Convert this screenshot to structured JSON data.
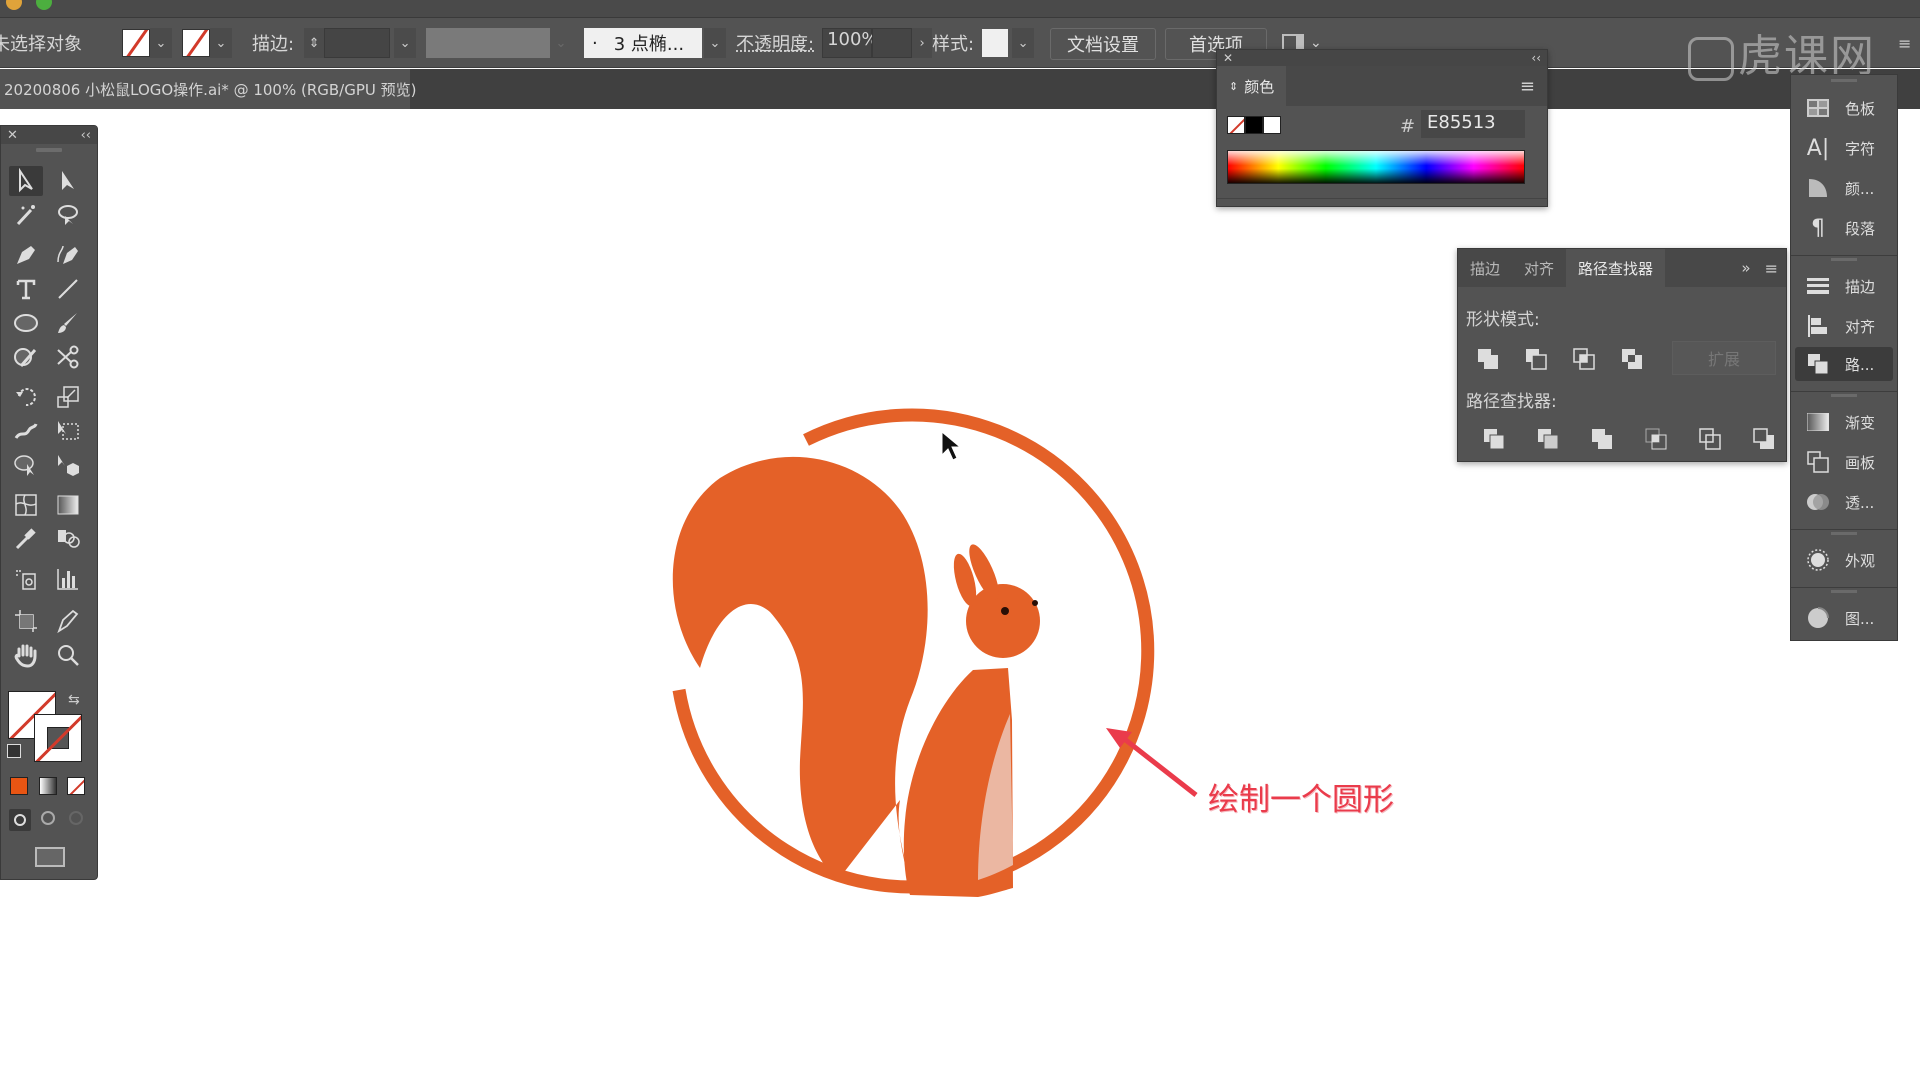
{
  "app": {
    "document_tab": "20200806 小松鼠LOGO操作.ai* @ 100% (RGB/GPU 预览)"
  },
  "control_bar": {
    "selection_label": "未选择对象",
    "stroke_label": "描边:",
    "stroke_value": "",
    "brush_value": "3 点椭...",
    "brush_bullet": "·",
    "opacity_label": "不透明度:",
    "opacity_value": "100%",
    "style_label": "样式:",
    "doc_settings_button": "文档设置",
    "preferences_button": "首选项"
  },
  "color_panel": {
    "title": "颜色",
    "hash_label": "#",
    "hex_value": "E85513",
    "collapse_glyph": "‹‹",
    "close_glyph": "✕"
  },
  "pathfinder_panel": {
    "tabs": [
      {
        "label": "描边",
        "active": false
      },
      {
        "label": "对齐",
        "active": false
      },
      {
        "label": "路径查找器",
        "active": true
      }
    ],
    "overflow_glyph": "»",
    "shape_modes_label": "形状模式:",
    "expand_button": "扩展",
    "pathfinders_label": "路径查找器:"
  },
  "right_dock": {
    "items": [
      {
        "label": "色板",
        "icon": "swatches-icon"
      },
      {
        "label": "字符",
        "icon": "character-icon"
      },
      {
        "label": "颜...",
        "icon": "color-guide-icon"
      },
      {
        "label": "段落",
        "icon": "paragraph-icon"
      },
      {
        "label": "描边",
        "icon": "stroke-icon"
      },
      {
        "label": "对齐",
        "icon": "align-icon"
      },
      {
        "label": "路...",
        "icon": "pathfinder-icon",
        "active": true
      },
      {
        "label": "渐变",
        "icon": "gradient-icon"
      },
      {
        "label": "画板",
        "icon": "artboards-icon"
      },
      {
        "label": "透...",
        "icon": "transparency-icon"
      },
      {
        "label": "外观",
        "icon": "appearance-icon"
      },
      {
        "label": "图...",
        "icon": "graphic-styles-icon"
      }
    ]
  },
  "tools_panel": {
    "close_glyph": "✕",
    "collapse_glyph": "‹‹"
  },
  "canvas": {
    "annotation": "绘制一个圆形",
    "logo_color": "#E85513",
    "belly_color": "#EBB7A2",
    "annotation_color": "#EA3B4B"
  },
  "watermark": {
    "text": "虎课网"
  }
}
